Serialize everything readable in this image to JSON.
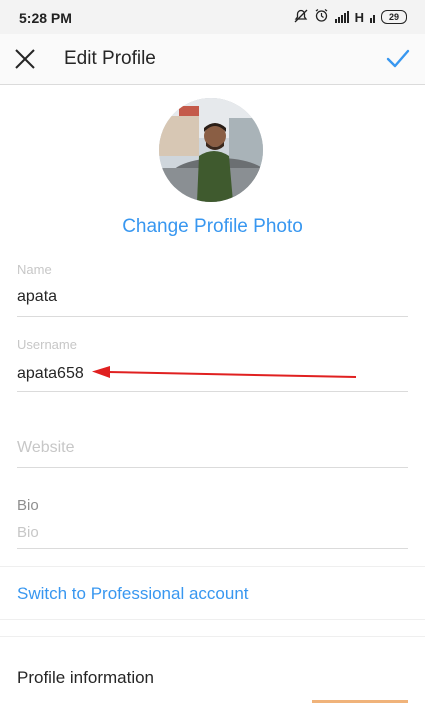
{
  "status_bar": {
    "time": "5:28 PM",
    "network": "H",
    "battery": "29"
  },
  "header": {
    "title": "Edit Profile"
  },
  "profile_photo": {
    "change_label": "Change Profile Photo"
  },
  "fields": {
    "name": {
      "label": "Name",
      "value": "apata"
    },
    "username": {
      "label": "Username",
      "value": "apata658"
    },
    "website": {
      "placeholder": "Website"
    },
    "bio": {
      "label": "Bio",
      "placeholder": "Bio"
    }
  },
  "switch_professional": "Switch to Professional account",
  "profile_information": "Profile information",
  "colors": {
    "accent": "#3897f0",
    "annotation_arrow": "#e02020"
  },
  "icons": [
    "close-icon",
    "checkmark-icon",
    "mute-icon",
    "alarm-icon",
    "signal-icon",
    "battery-icon"
  ]
}
